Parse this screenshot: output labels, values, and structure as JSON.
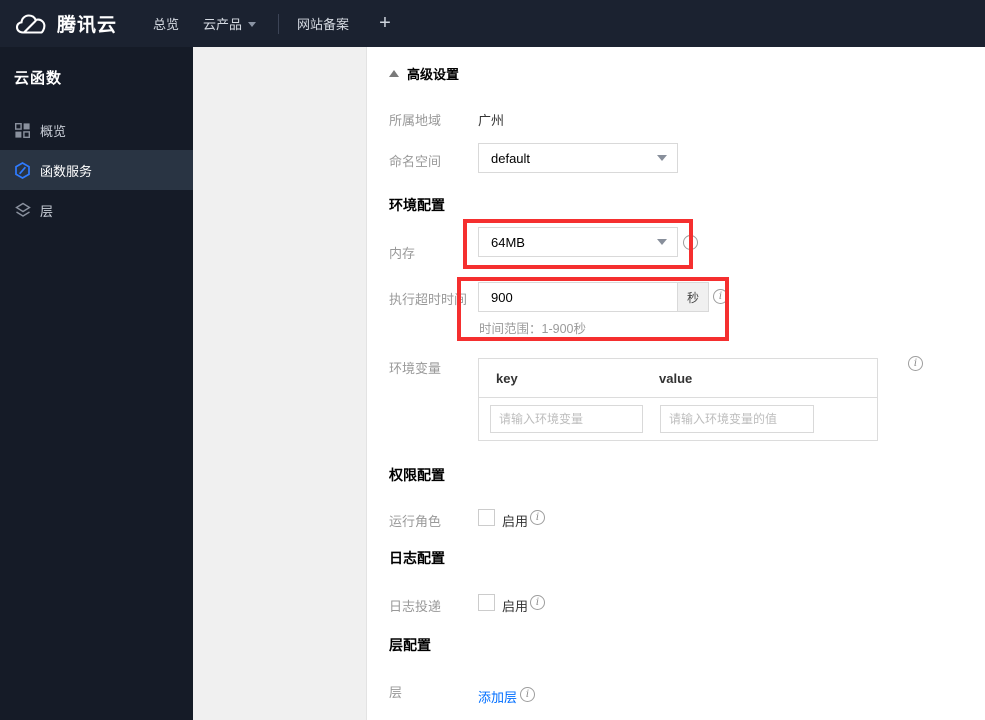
{
  "topnav": {
    "brand": "腾讯云",
    "items": [
      {
        "label": "总览"
      },
      {
        "label": "云产品"
      },
      {
        "label": "网站备案"
      }
    ],
    "plus_label": "+"
  },
  "sidebar": {
    "title": "云函数",
    "items": [
      {
        "label": "概览",
        "icon": "grid-icon",
        "active": false
      },
      {
        "label": "函数服务",
        "icon": "function-hexagon-icon",
        "active": true
      },
      {
        "label": "层",
        "icon": "layers-icon",
        "active": false
      }
    ]
  },
  "form": {
    "advanced_settings_label": "高级设置",
    "region": {
      "label": "所属地域",
      "value": "广州"
    },
    "namespace": {
      "label": "命名空间",
      "value": "default"
    },
    "section_env": "环境配置",
    "memory": {
      "label": "内存",
      "value": "64MB"
    },
    "timeout": {
      "label": "执行超时时间",
      "value": "900",
      "unit": "秒",
      "hint": "时间范围：1-900秒"
    },
    "env_vars": {
      "label": "环境变量",
      "key_header": "key",
      "value_header": "value",
      "key_placeholder": "请输入环境变量",
      "value_placeholder": "请输入环境变量的值"
    },
    "section_perm": "权限配置",
    "run_role": {
      "label": "运行角色",
      "checkbox_label": "启用",
      "checked": false
    },
    "section_log": "日志配置",
    "log_delivery": {
      "label": "日志投递",
      "checkbox_label": "启用",
      "checked": false
    },
    "section_layer": "层配置",
    "layer": {
      "label": "层",
      "add_link": "添加层"
    }
  },
  "colors": {
    "accent_blue": "#006eff",
    "annotation_red": "#f52f2f",
    "topnav_bg": "#1b2230",
    "sidebar_bg": "#151b27",
    "sidebar_active_bg": "#293443"
  }
}
